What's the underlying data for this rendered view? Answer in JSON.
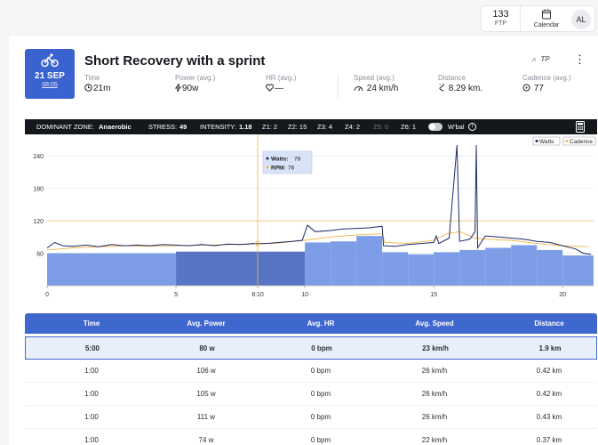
{
  "header": {
    "ftp": {
      "value": "133",
      "label": "FTP"
    },
    "calendar_label": "Calendar",
    "avatar_initials": "AL"
  },
  "workout": {
    "date_day": "21 SEP",
    "date_time": "08:05",
    "title": "Short Recovery with a sprint",
    "brand": "TP",
    "stats": [
      {
        "label": "Time",
        "value": "21m",
        "icon": "clock-icon"
      },
      {
        "label": "Power (avg.)",
        "value": "90w",
        "icon": "bolt-icon"
      },
      {
        "label": "HR (avg.)",
        "value": "—",
        "icon": "heart-icon"
      },
      {
        "label": "Speed (avg.)",
        "value": "24 km/h",
        "icon": "speedometer-icon"
      },
      {
        "label": "Distance",
        "value": "8.29 km.",
        "icon": "route-icon"
      },
      {
        "label": "Cadence (avg.)",
        "value": "77",
        "icon": "cadence-icon"
      }
    ]
  },
  "zones": {
    "dominant_label": "DOMINANT ZONE:",
    "dominant_value": "Anaerobic",
    "stress_label": "STRESS:",
    "stress_value": "49",
    "intensity_label": "INTENSITY:",
    "intensity_value": "1.18",
    "z1": "Z1: 2",
    "z2": "Z2: 15",
    "z3": "Z3: 4",
    "z4": "Z4: 2",
    "z5": "Z5: 0",
    "z6": "Z6: 1",
    "wbal_label": "W'bal"
  },
  "chart_data": {
    "type": "line",
    "xlim": [
      0,
      21.2
    ],
    "ylim": [
      0,
      270
    ],
    "x_ticks": [
      "0",
      "5",
      "8:10",
      "10",
      "15",
      "20"
    ],
    "x_tick_values": [
      0,
      5,
      8.17,
      10,
      15,
      20
    ],
    "y_ticks": [
      60,
      120,
      180,
      240
    ],
    "legend": [
      "Watts",
      "Cadence"
    ],
    "tooltip": {
      "watts_label": "Watts:",
      "watts_value": "78",
      "rpm_label": "RPM:",
      "rpm_value": "76"
    },
    "cursor_x": 8.17,
    "ftp_line": 120,
    "colors": {
      "watts": "#1f2a6b",
      "cadence": "#f0b64a",
      "blocks": "#7d9ee6",
      "blocks_dark": "#5775c4"
    },
    "blocks": [
      {
        "x0": 0,
        "x1": 5,
        "y": 60
      },
      {
        "x0": 5,
        "x1": 10,
        "y": 63
      },
      {
        "x0": 10,
        "x1": 11,
        "y": 80
      },
      {
        "x0": 11,
        "x1": 12,
        "y": 82
      },
      {
        "x0": 12,
        "x1": 13,
        "y": 92
      },
      {
        "x0": 13,
        "x1": 14,
        "y": 62
      },
      {
        "x0": 14,
        "x1": 15,
        "y": 58
      },
      {
        "x0": 15,
        "x1": 16,
        "y": 62
      },
      {
        "x0": 16,
        "x1": 17,
        "y": 66
      },
      {
        "x0": 17,
        "x1": 18,
        "y": 70
      },
      {
        "x0": 18,
        "x1": 19,
        "y": 75
      },
      {
        "x0": 19,
        "x1": 20,
        "y": 66
      },
      {
        "x0": 20,
        "x1": 21.2,
        "y": 56
      }
    ],
    "series": [
      {
        "name": "Watts",
        "points": [
          [
            0,
            70
          ],
          [
            0.3,
            80
          ],
          [
            0.6,
            74
          ],
          [
            1,
            73
          ],
          [
            1.5,
            75
          ],
          [
            2,
            72
          ],
          [
            2.5,
            76
          ],
          [
            3,
            74
          ],
          [
            3.5,
            75
          ],
          [
            4,
            74
          ],
          [
            4.5,
            76
          ],
          [
            5,
            75
          ],
          [
            5.5,
            74
          ],
          [
            6,
            76
          ],
          [
            6.5,
            74
          ],
          [
            7,
            77
          ],
          [
            7.5,
            76
          ],
          [
            8,
            78
          ],
          [
            8.5,
            78
          ],
          [
            9,
            80
          ],
          [
            9.5,
            82
          ],
          [
            9.9,
            84
          ],
          [
            10.1,
            112
          ],
          [
            10.4,
            100
          ],
          [
            11,
            102
          ],
          [
            11.5,
            105
          ],
          [
            12,
            106
          ],
          [
            12.5,
            107
          ],
          [
            13,
            110
          ],
          [
            13.05,
            74
          ],
          [
            13.5,
            73
          ],
          [
            14,
            76
          ],
          [
            14.5,
            78
          ],
          [
            15,
            80
          ],
          [
            15.1,
            92
          ],
          [
            15.2,
            78
          ],
          [
            15.6,
            88
          ],
          [
            15.9,
            260
          ],
          [
            16,
            82
          ],
          [
            16.4,
            86
          ],
          [
            16.6,
            100
          ],
          [
            16.65,
            260
          ],
          [
            16.7,
            70
          ],
          [
            17,
            92
          ],
          [
            17.5,
            90
          ],
          [
            18,
            88
          ],
          [
            18.5,
            86
          ],
          [
            19,
            82
          ],
          [
            19.5,
            80
          ],
          [
            20,
            74
          ],
          [
            20.5,
            68
          ],
          [
            20.8,
            60
          ],
          [
            21.1,
            58
          ]
        ]
      },
      {
        "name": "Cadence",
        "points": [
          [
            0,
            66
          ],
          [
            1,
            70
          ],
          [
            2,
            72
          ],
          [
            3,
            74
          ],
          [
            4,
            73
          ],
          [
            5,
            74
          ],
          [
            6,
            75
          ],
          [
            7,
            76
          ],
          [
            8,
            77
          ],
          [
            9,
            79
          ],
          [
            10,
            84
          ],
          [
            11,
            90
          ],
          [
            12,
            94
          ],
          [
            13,
            96
          ],
          [
            13.1,
            80
          ],
          [
            14,
            78
          ],
          [
            15,
            84
          ],
          [
            15.5,
            96
          ],
          [
            16,
            100
          ],
          [
            16.6,
            88
          ],
          [
            17,
            86
          ],
          [
            18,
            84
          ],
          [
            19,
            78
          ],
          [
            20,
            74
          ],
          [
            21,
            72
          ]
        ]
      }
    ]
  },
  "table": {
    "headers": [
      "Time",
      "Avg. Power",
      "Avg. HR",
      "Avg. Speed",
      "Distance"
    ],
    "rows": [
      [
        "5:00",
        "80 w",
        "0 bpm",
        "23 km/h",
        "1.9 km"
      ],
      [
        "1:00",
        "106 w",
        "0 bpm",
        "26 km/h",
        "0.42 km"
      ],
      [
        "1:00",
        "105 w",
        "0 bpm",
        "26 km/h",
        "0.42 km"
      ],
      [
        "1:00",
        "111 w",
        "0 bpm",
        "26 km/h",
        "0.43 km"
      ],
      [
        "1:00",
        "74 w",
        "0 bpm",
        "22 km/h",
        "0.37 km"
      ]
    ]
  }
}
